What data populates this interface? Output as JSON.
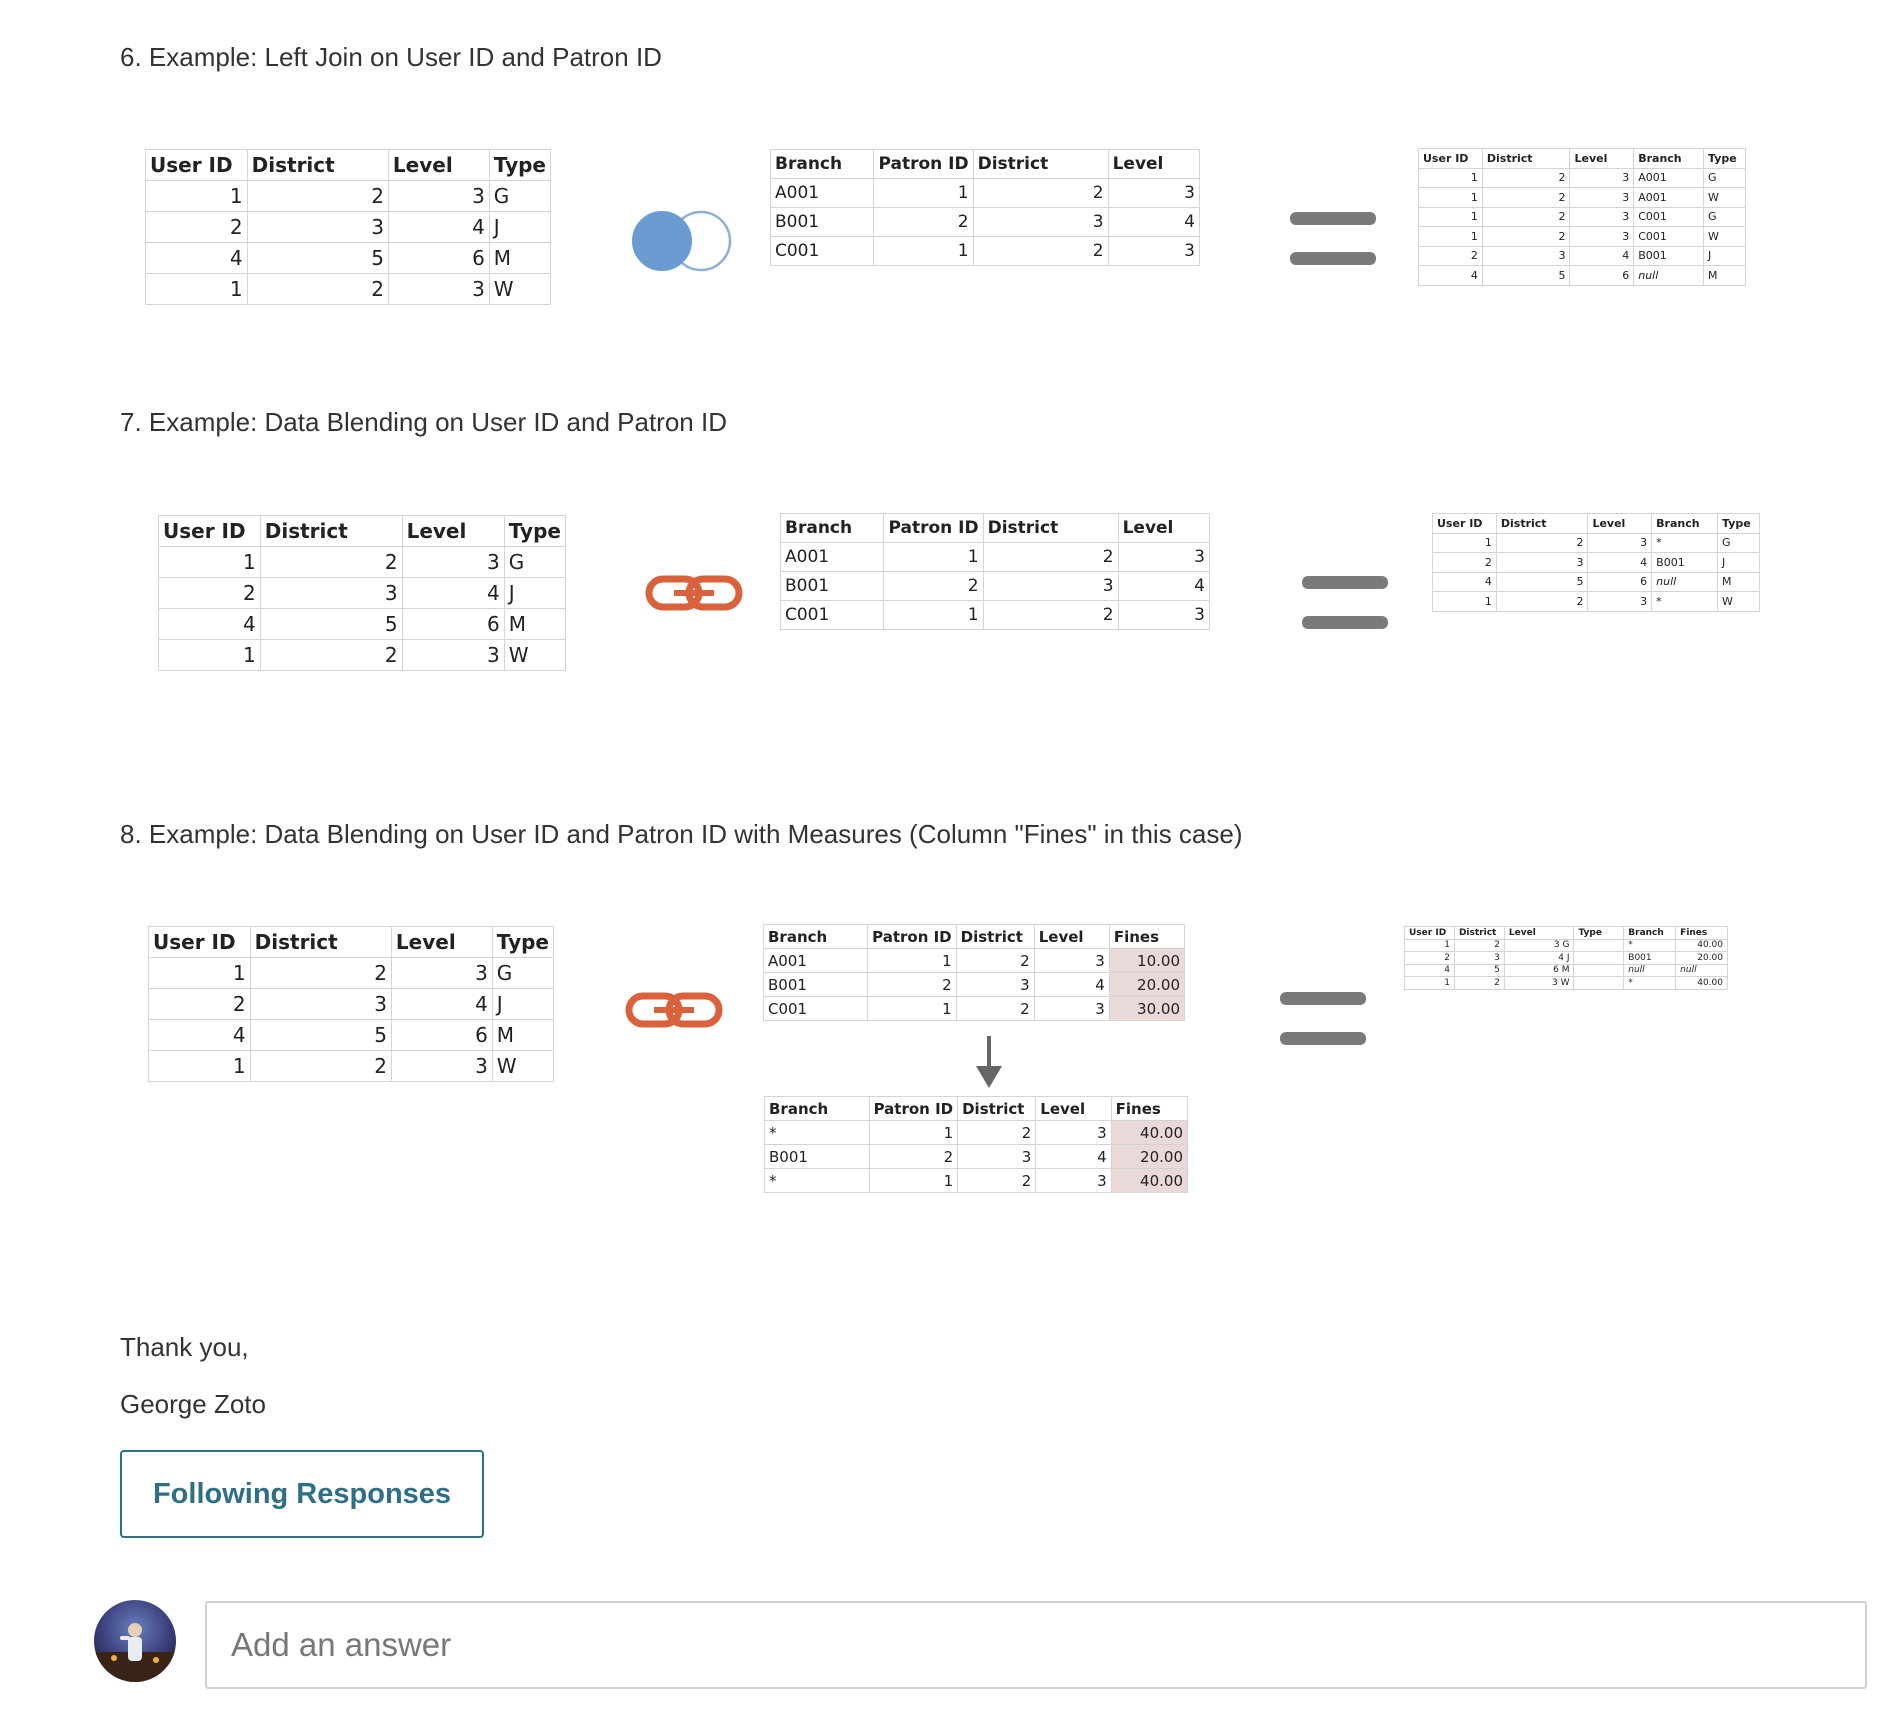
{
  "sections": [
    {
      "heading": "6. Example: Left Join on User ID and Patron ID",
      "operator_icon": "venn-left-join-icon",
      "left_table": {
        "headers": [
          "User ID",
          "District",
          "Level",
          "Type"
        ],
        "rows": [
          [
            "1",
            "2",
            "3",
            "G"
          ],
          [
            "2",
            "3",
            "4",
            "J"
          ],
          [
            "4",
            "5",
            "6",
            "M"
          ],
          [
            "1",
            "2",
            "3",
            "W"
          ]
        ]
      },
      "right_table": {
        "headers": [
          "Branch",
          "Patron ID",
          "District",
          "Level"
        ],
        "rows": [
          [
            "A001",
            "1",
            "2",
            "3"
          ],
          [
            "B001",
            "2",
            "3",
            "4"
          ],
          [
            "C001",
            "1",
            "2",
            "3"
          ]
        ]
      },
      "result_table": {
        "headers": [
          "User ID",
          "District",
          "Level",
          "Branch",
          "Type"
        ],
        "rows": [
          [
            "1",
            "2",
            "3",
            "A001",
            "G"
          ],
          [
            "1",
            "2",
            "3",
            "A001",
            "W"
          ],
          [
            "1",
            "2",
            "3",
            "C001",
            "G"
          ],
          [
            "1",
            "2",
            "3",
            "C001",
            "W"
          ],
          [
            "2",
            "3",
            "4",
            "B001",
            "J"
          ],
          [
            "4",
            "5",
            "6",
            "null",
            "M"
          ]
        ]
      }
    },
    {
      "heading": "7. Example: Data Blending on User ID and Patron ID",
      "operator_icon": "chain-link-icon",
      "left_table": {
        "headers": [
          "User ID",
          "District",
          "Level",
          "Type"
        ],
        "rows": [
          [
            "1",
            "2",
            "3",
            "G"
          ],
          [
            "2",
            "3",
            "4",
            "J"
          ],
          [
            "4",
            "5",
            "6",
            "M"
          ],
          [
            "1",
            "2",
            "3",
            "W"
          ]
        ]
      },
      "right_table": {
        "headers": [
          "Branch",
          "Patron ID",
          "District",
          "Level"
        ],
        "rows": [
          [
            "A001",
            "1",
            "2",
            "3"
          ],
          [
            "B001",
            "2",
            "3",
            "4"
          ],
          [
            "C001",
            "1",
            "2",
            "3"
          ]
        ]
      },
      "result_table": {
        "headers": [
          "User ID",
          "District",
          "Level",
          "Branch",
          "Type"
        ],
        "rows": [
          [
            "1",
            "2",
            "3",
            "*",
            "G"
          ],
          [
            "2",
            "3",
            "4",
            "B001",
            "J"
          ],
          [
            "4",
            "5",
            "6",
            "null",
            "M"
          ],
          [
            "1",
            "2",
            "3",
            "*",
            "W"
          ]
        ]
      }
    },
    {
      "heading": "8. Example: Data Blending on User ID and Patron ID with Measures (Column \"Fines\" in this case)",
      "operator_icon": "chain-link-icon",
      "left_table": {
        "headers": [
          "User ID",
          "District",
          "Level",
          "Type"
        ],
        "rows": [
          [
            "1",
            "2",
            "3",
            "G"
          ],
          [
            "2",
            "3",
            "4",
            "J"
          ],
          [
            "4",
            "5",
            "6",
            "M"
          ],
          [
            "1",
            "2",
            "3",
            "W"
          ]
        ]
      },
      "right_table": {
        "headers": [
          "Branch",
          "Patron ID",
          "District",
          "Level",
          "Fines"
        ],
        "rows": [
          [
            "A001",
            "1",
            "2",
            "3",
            "10.00"
          ],
          [
            "B001",
            "2",
            "3",
            "4",
            "20.00"
          ],
          [
            "C001",
            "1",
            "2",
            "3",
            "30.00"
          ]
        ]
      },
      "aggregated_table": {
        "headers": [
          "Branch",
          "Patron ID",
          "District",
          "Level",
          "Fines"
        ],
        "rows": [
          [
            "*",
            "1",
            "2",
            "3",
            "40.00"
          ],
          [
            "B001",
            "2",
            "3",
            "4",
            "20.00"
          ],
          [
            "*",
            "1",
            "2",
            "3",
            "40.00"
          ]
        ]
      },
      "result_table": {
        "headers": [
          "User ID",
          "District",
          "Level",
          "Type",
          "Branch",
          "Fines"
        ],
        "rows": [
          [
            "1",
            "2",
            "3 G",
            "",
            "*",
            "40.00"
          ],
          [
            "2",
            "3",
            "4 J",
            "",
            "B001",
            "20.00"
          ],
          [
            "4",
            "5",
            "6 M",
            "",
            "null",
            "null"
          ],
          [
            "1",
            "2",
            "3 W",
            "",
            "*",
            "40.00"
          ]
        ]
      }
    }
  ],
  "closing": {
    "thanks": "Thank you,",
    "signature": "George Zoto"
  },
  "follow_button": "Following Responses",
  "answer_input": {
    "placeholder": "Add an answer",
    "value": ""
  },
  "colors": {
    "accent": "#2e6f88",
    "venn_fill": "#6a9bd1",
    "chain": "#d9623c",
    "equals": "#7a7a7a",
    "fines_bg": "#ead9d9"
  }
}
